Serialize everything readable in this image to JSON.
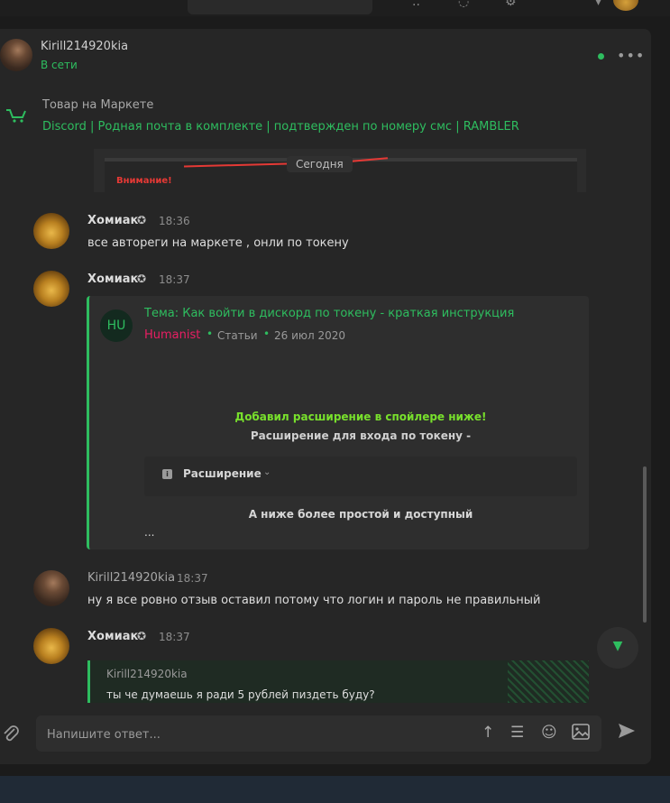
{
  "header": {
    "username": "Kirill214920kia",
    "status": "В сети",
    "more_label": "•••"
  },
  "market": {
    "label": "Товар на Маркете",
    "title": "Discord | Родная почта в комплекте | подтвержден по номеру смс | RAMBLER"
  },
  "date_divider": "Сегодня",
  "warning": "Внимание!",
  "messages": [
    {
      "author": "Хомиак",
      "time": "18:36",
      "text": "все автореги на маркете , онли по токену"
    },
    {
      "author": "Хомиак",
      "time": "18:37"
    },
    {
      "author": "Kirill214920kia",
      "time": "18:37",
      "text": "ну я все ровно отзыв оставил потому что логин и пароль не правильный"
    },
    {
      "author": "Хомиак",
      "time": "18:37"
    }
  ],
  "quote": {
    "avatar_initials": "HU",
    "title": "Тема: Как войти в дискорд по токену - краткая инструкция",
    "author": "Humanist",
    "category": "Статьи",
    "date": "26 июл 2020",
    "added_line": "Добавил расширение в спойлере ниже!",
    "ext_line": "Расширение для входа по токену -",
    "spoiler_label": "Расширение",
    "lower_line": "А ниже более простой и доступный",
    "ellipsis": "..."
  },
  "reply": {
    "author": "Kirill214920kia",
    "text": "ты че думаешь я ради 5 рублей пиздеть буду?"
  },
  "composer": {
    "placeholder": "Напишите ответ..."
  },
  "icons": {
    "attach": "paperclip-icon",
    "send": "send-icon",
    "scroll_down": "chevron-down-icon",
    "market": "cart-icon"
  },
  "colors": {
    "accent": "#2ebd5f",
    "author_pink": "#e91e63",
    "warning": "#e53935",
    "highlight": "#78e02c"
  }
}
